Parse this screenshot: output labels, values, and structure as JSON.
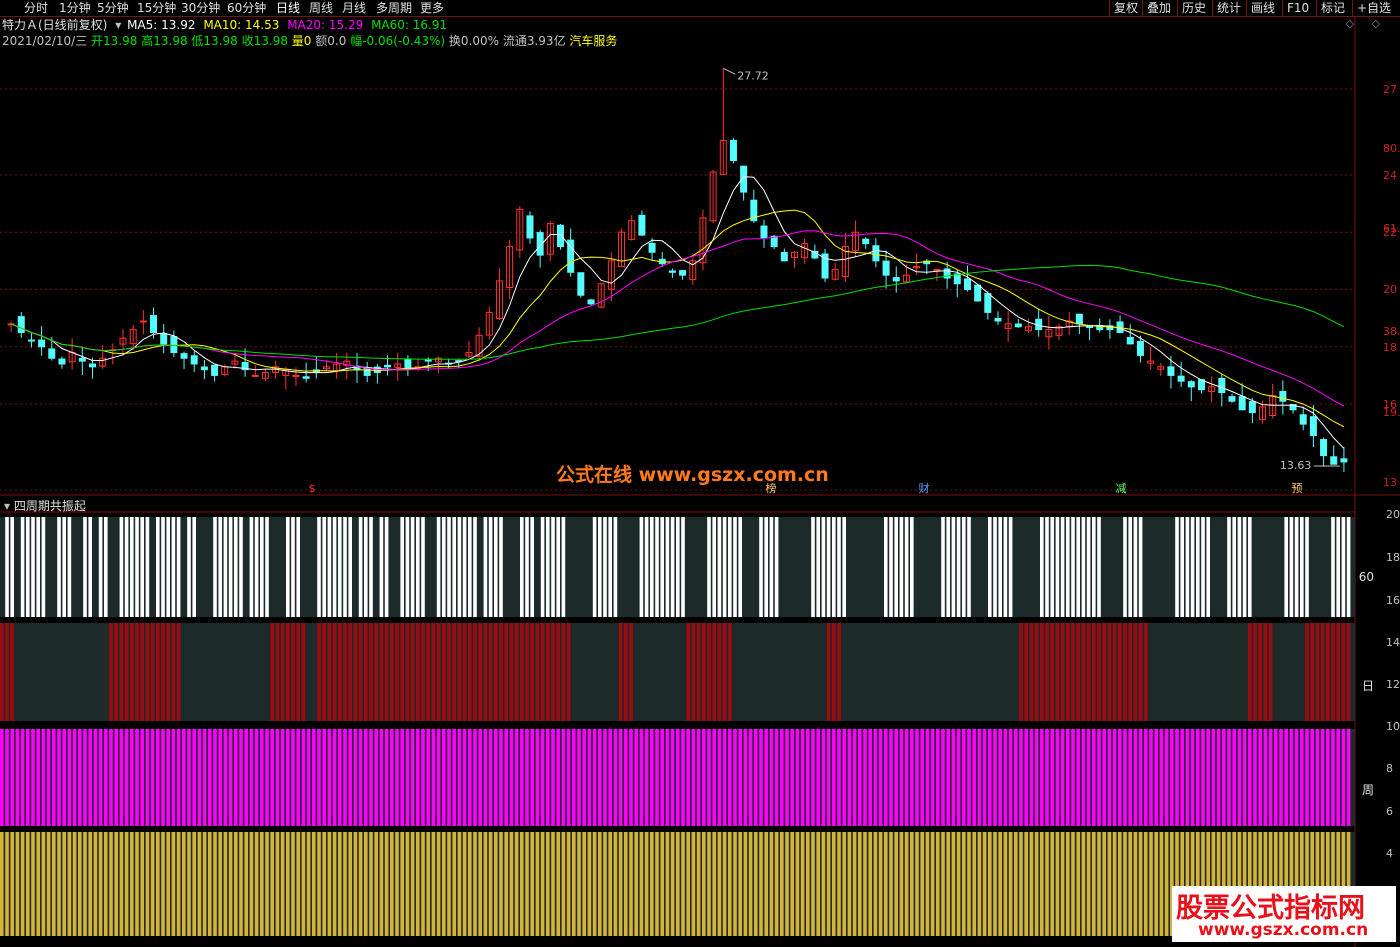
{
  "toolbar": {
    "periods": [
      "分时",
      "1分钟",
      "5分钟",
      "15分钟",
      "30分钟",
      "60分钟",
      "日线",
      "周线",
      "月线",
      "多周期",
      "更多"
    ],
    "active": "日线",
    "right_buttons": [
      "复权",
      "叠加",
      "历史",
      "统计",
      "画线",
      "F10",
      "标记",
      "+自选"
    ]
  },
  "header": {
    "stock_name": "特力Ａ(日线前复权)",
    "ma5_label": "MA5: 13.92",
    "ma10_label": "MA10: 14.53",
    "ma20_label": "MA20: 15.29",
    "ma60_label": "MA60: 16.91",
    "date": "2021/02/10/三",
    "open": "开13.98",
    "high": "高13.98",
    "low": "低13.98",
    "close": "收13.98",
    "volume": "量0",
    "amount": "额0.0",
    "change": "幅-0.06(-0.43%)",
    "turnover": "换0.00%",
    "float": "流通3.93亿",
    "sector": "汽车服务"
  },
  "colors": {
    "up": "#ff3232",
    "down": "#54fcfc",
    "ma5": "#ffffff",
    "ma10": "#ffff00",
    "ma20": "#ff00ff",
    "ma60": "#00e000",
    "grid": "#7a1010",
    "bar_white": "#ffffff",
    "bar_red": "#9e0a12",
    "bar_magenta": "#ff00ff",
    "bar_gold": "#d6b43a"
  },
  "annotations": {
    "high_label": "27.72",
    "low_label": "13.63",
    "markers": [
      {
        "text": "$",
        "color": "#ff3232"
      },
      {
        "text": "榜",
        "color": "#ffcc66"
      },
      {
        "text": "财",
        "color": "#5aa0ff"
      },
      {
        "text": "减",
        "color": "#66ff66"
      },
      {
        "text": "预",
        "color": "#ffcc66"
      }
    ]
  },
  "axis": {
    "price_ticks": [
      "27",
      "24",
      "22",
      "20",
      "18",
      "16",
      "13"
    ],
    "secondary_ticks": [
      "80.",
      "61.",
      "38.",
      "19."
    ],
    "sub_ticks": [
      "20",
      "18",
      "16",
      "14",
      "12",
      "10",
      "8",
      "6",
      "4"
    ]
  },
  "sub_panel": {
    "title": "四周期共振起",
    "row_labels": [
      "60",
      "日",
      "周"
    ]
  },
  "watermark": {
    "top": "公式在线  www.gszx.com.cn",
    "corner_main": "股票公式指标网",
    "corner_sub": "www.gszx.com.cn"
  },
  "chart_data": {
    "type": "candlestick",
    "title": "",
    "ylim": [
      13,
      28.5
    ],
    "close_series_approx": [
      18.8,
      18.5,
      18.2,
      18.0,
      17.6,
      17.4,
      17.8,
      17.5,
      17.3,
      17.6,
      17.9,
      18.3,
      18.6,
      18.9,
      18.5,
      18.1,
      17.8,
      17.6,
      17.4,
      17.2,
      17.0,
      17.3,
      17.5,
      17.2,
      17.0,
      17.1,
      17.3,
      17.2,
      17.0,
      16.9,
      17.1,
      17.3,
      17.4,
      17.5,
      17.2,
      17.0,
      17.1,
      17.3,
      17.4,
      17.2,
      17.3,
      17.5,
      17.6,
      17.4,
      17.5,
      17.8,
      18.4,
      19.2,
      20.3,
      21.5,
      22.8,
      21.8,
      21.2,
      22.3,
      21.5,
      20.6,
      19.8,
      19.5,
      20.2,
      21.0,
      22.0,
      22.4,
      21.9,
      21.3,
      20.9,
      20.6,
      20.5,
      21.0,
      22.5,
      24.1,
      25.2,
      24.5,
      23.4,
      22.4,
      21.8,
      21.5,
      21.0,
      21.3,
      21.6,
      21.1,
      20.4,
      20.7,
      21.5,
      22.0,
      21.6,
      21.0,
      20.5,
      20.3,
      20.5,
      20.8,
      20.9,
      20.7,
      20.4,
      20.2,
      20.0,
      19.6,
      19.2,
      18.9,
      18.8,
      18.7,
      18.7,
      18.6,
      18.6,
      18.7,
      18.9,
      18.8,
      18.7,
      18.6,
      18.6,
      18.5,
      18.1,
      17.7,
      17.5,
      17.3,
      17.0,
      16.8,
      16.6,
      16.5,
      16.6,
      16.4,
      16.1,
      15.8,
      15.7,
      15.9,
      16.3,
      16.1,
      15.8,
      15.3,
      14.9,
      14.2,
      13.9,
      13.98
    ],
    "high": 27.72,
    "low": 13.63
  }
}
